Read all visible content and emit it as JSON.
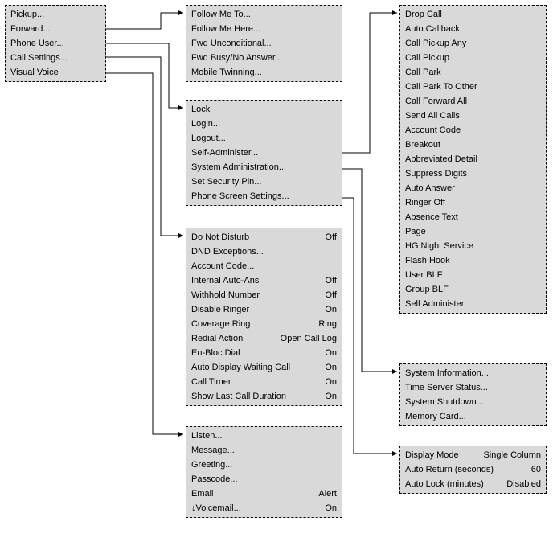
{
  "main_menu": {
    "items": [
      {
        "label": "Pickup..."
      },
      {
        "label": "Forward..."
      },
      {
        "label": "Phone User..."
      },
      {
        "label": "Call Settings..."
      },
      {
        "label": "Visual Voice"
      }
    ]
  },
  "forward_menu": {
    "items": [
      {
        "label": "Follow Me To..."
      },
      {
        "label": "Follow Me Here..."
      },
      {
        "label": "Fwd Unconditional..."
      },
      {
        "label": "Fwd Busy/No Answer..."
      },
      {
        "label": "Mobile Twinning..."
      }
    ]
  },
  "phone_user_menu": {
    "items": [
      {
        "label": "Lock"
      },
      {
        "label": "Login..."
      },
      {
        "label": "Logout..."
      },
      {
        "label": "Self-Administer..."
      },
      {
        "label": "System Administration..."
      },
      {
        "label": "Set Security Pin..."
      },
      {
        "label": "Phone Screen Settings..."
      }
    ]
  },
  "call_settings_menu": {
    "items": [
      {
        "label": "Do Not Disturb",
        "value": "Off"
      },
      {
        "label": "DND Exceptions..."
      },
      {
        "label": "Account Code..."
      },
      {
        "label": "Internal Auto-Ans",
        "value": "Off"
      },
      {
        "label": "Withhold Number",
        "value": "Off"
      },
      {
        "label": "Disable Ringer",
        "value": "On"
      },
      {
        "label": "Coverage Ring",
        "value": "Ring"
      },
      {
        "label": "Redial Action",
        "value": "Open Call Log"
      },
      {
        "label": "En-Bloc Dial",
        "value": "On"
      },
      {
        "label": "Auto Display Waiting Call",
        "value": "On"
      },
      {
        "label": "Call Timer",
        "value": "On"
      },
      {
        "label": "Show Last Call Duration",
        "value": "On"
      }
    ]
  },
  "visual_voice_menu": {
    "items": [
      {
        "label": "Listen..."
      },
      {
        "label": "Message..."
      },
      {
        "label": "Greeting..."
      },
      {
        "label": "Passcode..."
      },
      {
        "label": "Email",
        "value": "Alert"
      },
      {
        "label": "↓Voicemail...",
        "value": "On"
      }
    ]
  },
  "pickup_menu": {
    "items": [
      {
        "label": "Drop Call"
      },
      {
        "label": "Auto Callback"
      },
      {
        "label": "Call Pickup Any"
      },
      {
        "label": "Call Pickup"
      },
      {
        "label": "Call Park"
      },
      {
        "label": "Call Park To Other"
      },
      {
        "label": "Call Forward All"
      },
      {
        "label": "Send All Calls"
      },
      {
        "label": "Account Code"
      },
      {
        "label": "Breakout"
      },
      {
        "label": "Abbreviated Detail"
      },
      {
        "label": "Suppress Digits"
      },
      {
        "label": "Auto Answer"
      },
      {
        "label": "Ringer Off"
      },
      {
        "label": "Absence Text"
      },
      {
        "label": "Page"
      },
      {
        "label": "HG Night Service"
      },
      {
        "label": "Flash Hook"
      },
      {
        "label": "User BLF"
      },
      {
        "label": "Group BLF"
      },
      {
        "label": "Self Administer"
      }
    ]
  },
  "system_admin_menu": {
    "items": [
      {
        "label": "System Information..."
      },
      {
        "label": "Time Server Status..."
      },
      {
        "label": "System Shutdown..."
      },
      {
        "label": "Memory Card..."
      }
    ]
  },
  "screen_settings_menu": {
    "items": [
      {
        "label": "Display Mode",
        "value": "Single Column"
      },
      {
        "label": "Auto Return (seconds)",
        "value": "60"
      },
      {
        "label": "Auto Lock (minutes)",
        "value": "Disabled"
      }
    ]
  }
}
